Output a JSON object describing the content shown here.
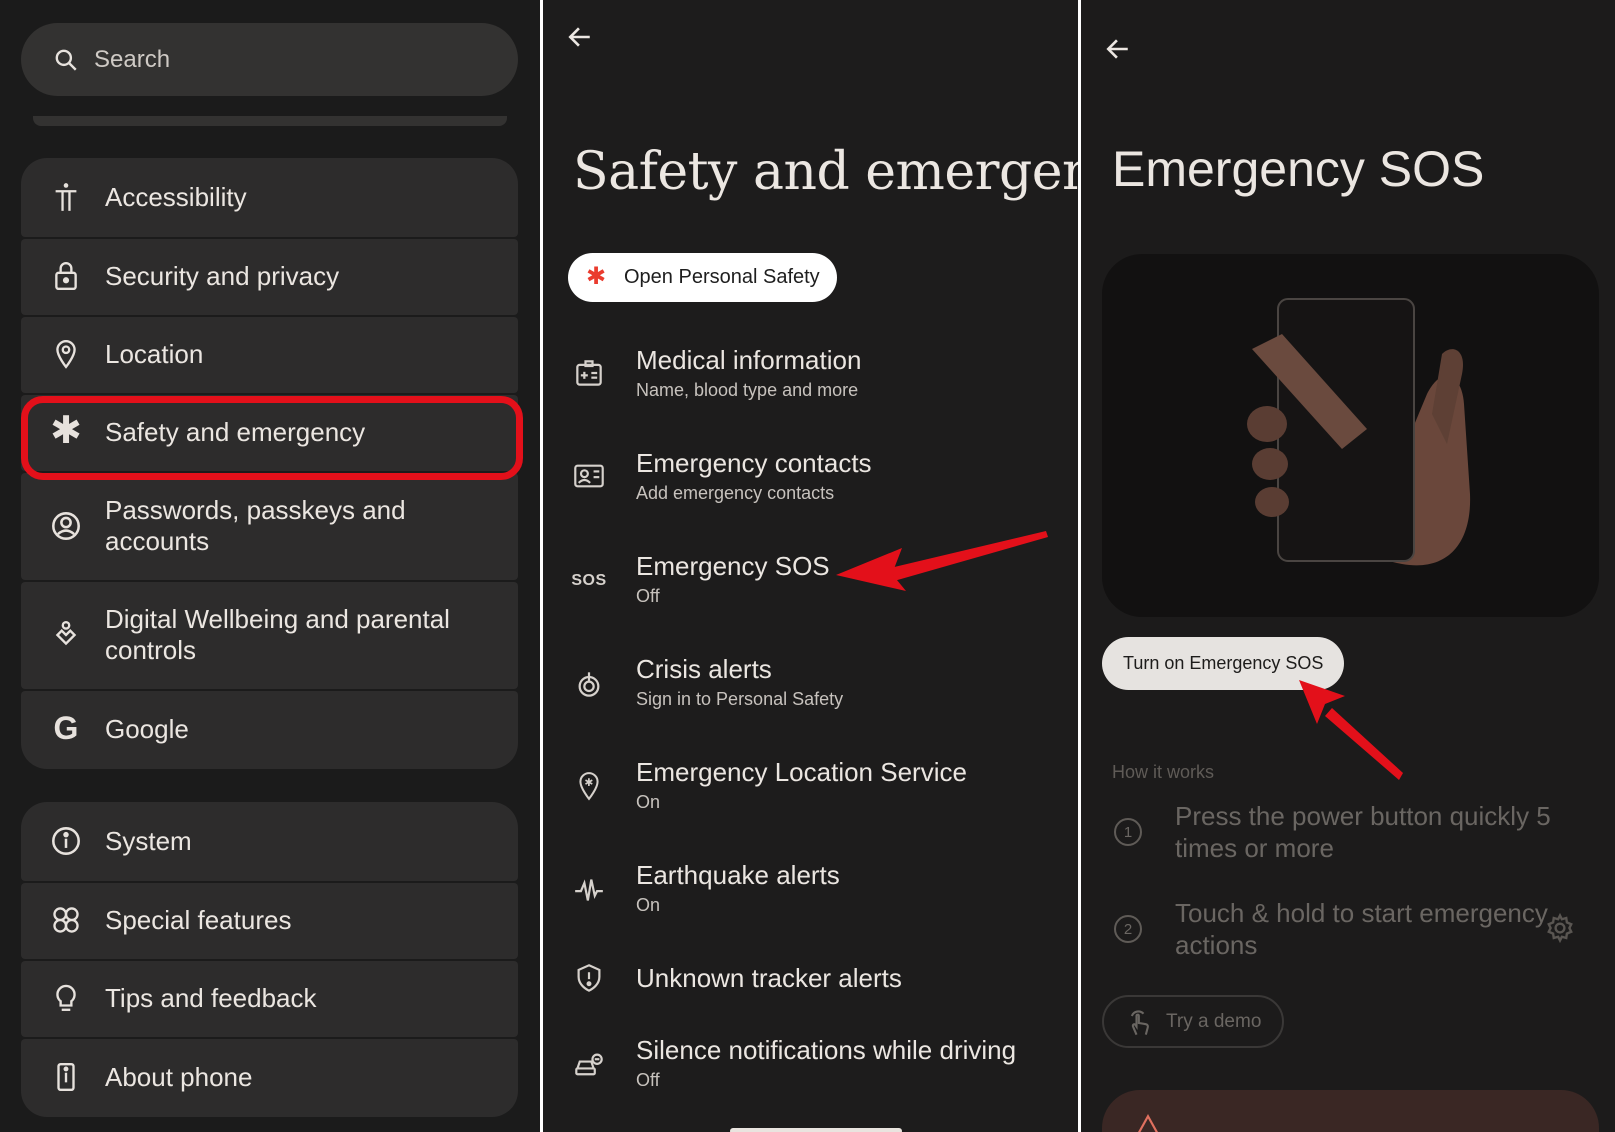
{
  "panel1": {
    "search": {
      "placeholder": "Search",
      "icon": "search-icon"
    },
    "group1": [
      {
        "label": "Accessibility",
        "icon": "accessibility-icon"
      },
      {
        "label": "Security and privacy",
        "icon": "lock-icon"
      },
      {
        "label": "Location",
        "icon": "location-pin-icon"
      },
      {
        "label": "Safety and emergency",
        "icon": "asterisk-icon",
        "highlighted": true
      },
      {
        "label": "Passwords, passkeys and accounts",
        "icon": "account-circle-icon"
      },
      {
        "label": "Digital Wellbeing and parental controls",
        "icon": "wellbeing-icon"
      },
      {
        "label": "Google",
        "icon": "google-g-icon"
      }
    ],
    "group2": [
      {
        "label": "System",
        "icon": "info-icon"
      },
      {
        "label": "Special features",
        "icon": "special-features-icon"
      },
      {
        "label": "Tips and feedback",
        "icon": "lightbulb-icon"
      },
      {
        "label": "About phone",
        "icon": "phone-icon"
      }
    ],
    "highlight_color": "#e3101a"
  },
  "panel2": {
    "title": "Safety and emergency",
    "open_button": "Open Personal Safety",
    "items": [
      {
        "title": "Medical information",
        "subtitle": "Name, blood type and more",
        "icon": "medical-id-icon"
      },
      {
        "title": "Emergency contacts",
        "subtitle": "Add emergency contacts",
        "icon": "contact-card-icon"
      },
      {
        "title": "Emergency SOS",
        "subtitle": "Off",
        "icon": "sos-icon"
      },
      {
        "title": "Crisis alerts",
        "subtitle": "Sign in to Personal Safety",
        "icon": "crisis-alert-icon"
      },
      {
        "title": "Emergency Location Service",
        "subtitle": "On",
        "icon": "emergency-location-icon"
      },
      {
        "title": "Earthquake alerts",
        "subtitle": "On",
        "icon": "seismic-wave-icon"
      },
      {
        "title": "Unknown tracker alerts",
        "subtitle": "",
        "icon": "shield-alert-icon"
      },
      {
        "title": "Silence notifications while driving",
        "subtitle": "Off",
        "icon": "driving-icon"
      }
    ],
    "sos_glyph": "SOS"
  },
  "panel3": {
    "title": "Emergency SOS",
    "turn_on_button": "Turn on Emergency SOS",
    "how_it_works": "How it works",
    "steps": [
      {
        "number": "1",
        "text": "Press the power button quickly 5 times or more"
      },
      {
        "number": "2",
        "text": "Touch & hold to start emergency actions"
      }
    ],
    "demo_button": "Try a demo"
  },
  "colors": {
    "background_dark": "#1b1b1b",
    "card": "#2d2c2c",
    "annotation_red": "#e3101a",
    "accent_blue": "#3a6fd8",
    "accent_red": "#ea3b2e"
  }
}
